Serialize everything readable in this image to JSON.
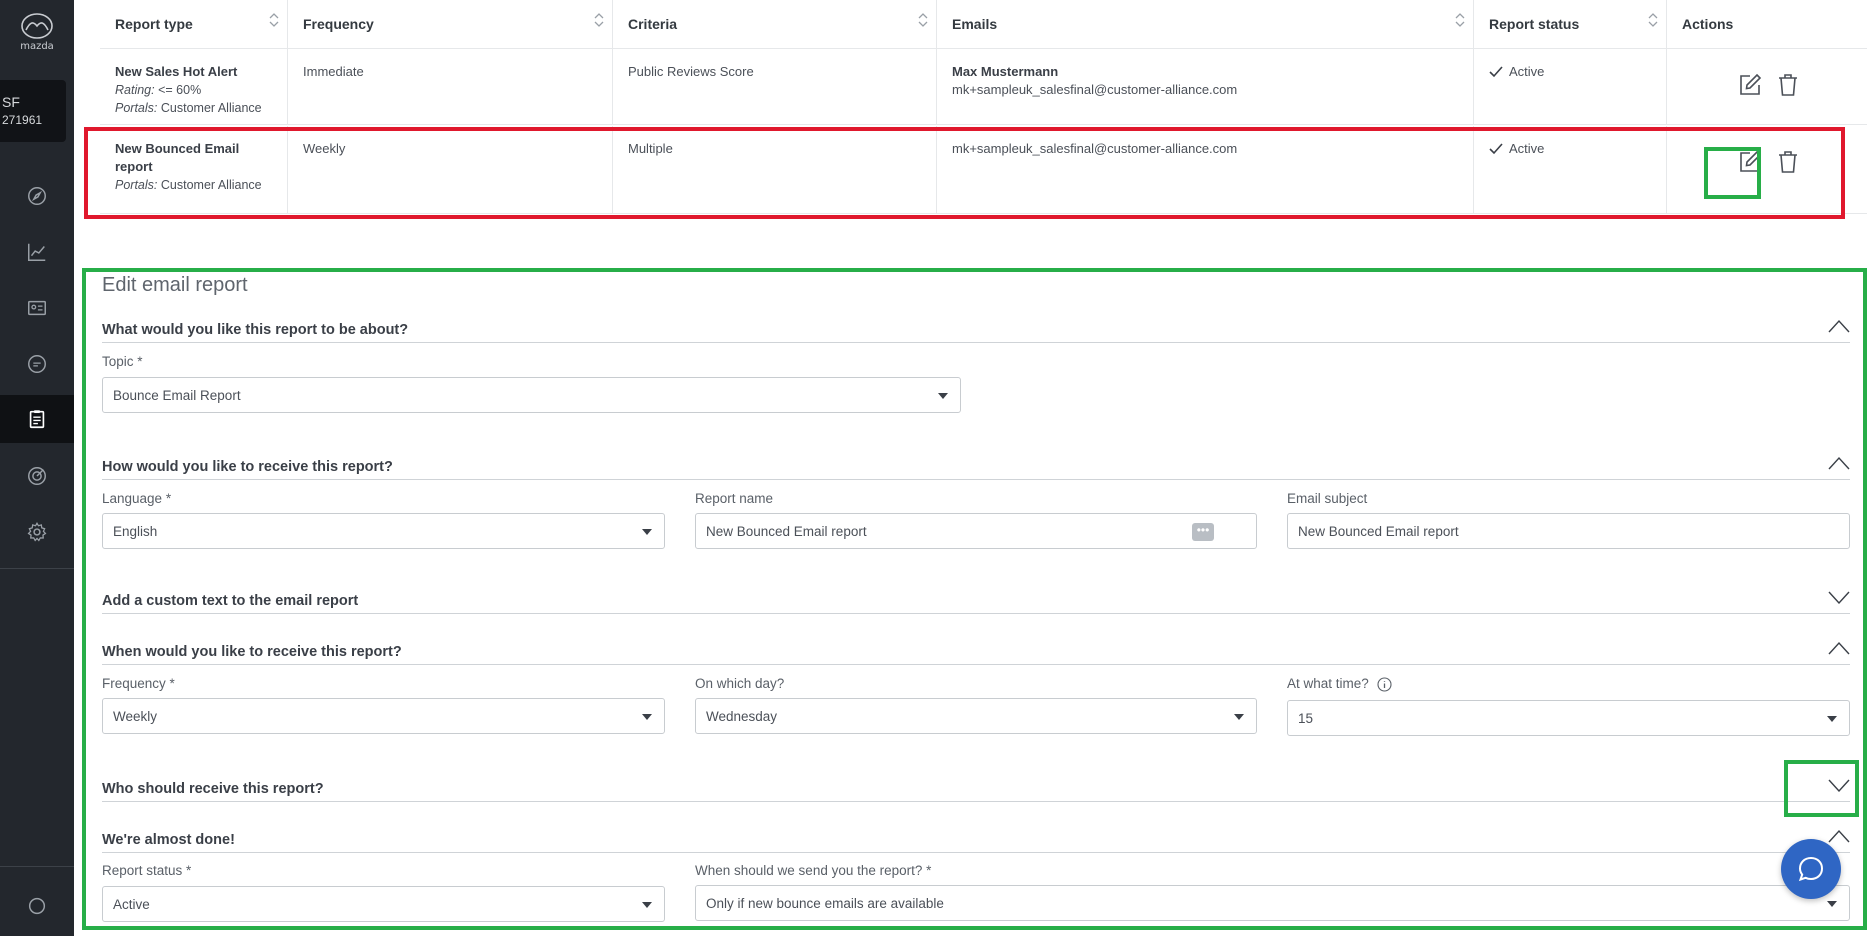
{
  "sidebar": {
    "logo_text": "mazda",
    "account": {
      "initials": "SF",
      "id": "271961"
    },
    "items": [
      {
        "icon": "compass-icon"
      },
      {
        "icon": "chart-line-icon"
      },
      {
        "icon": "id-card-icon"
      },
      {
        "icon": "chat-bubble-icon"
      },
      {
        "icon": "clipboard-icon",
        "active": true
      },
      {
        "icon": "target-icon"
      },
      {
        "icon": "gear-icon"
      }
    ],
    "bottom_icon": "circle-icon"
  },
  "table": {
    "headers": [
      "Report type",
      "Frequency",
      "Criteria",
      "Emails",
      "Report status",
      "Actions"
    ],
    "rows": [
      {
        "title": "New Sales Hot Alert",
        "rating_label": "Rating:",
        "rating_value": "<= 60%",
        "portals_label": "Portals:",
        "portals_value": "Customer Alliance",
        "frequency": "Immediate",
        "criteria": "Public Reviews Score",
        "email_name": "Max Mustermann",
        "email": "mk+sampleuk_salesfinal@customer-alliance.com",
        "status": "Active"
      },
      {
        "title": "New Bounced Email report",
        "portals_label": "Portals:",
        "portals_value": "Customer Alliance",
        "frequency": "Weekly",
        "criteria": "Multiple",
        "email": "mk+sampleuk_salesfinal@customer-alliance.com",
        "status": "Active"
      }
    ]
  },
  "form": {
    "title": "Edit email report",
    "sections": {
      "about": "What would you like this report to be about?",
      "receive": "How would you like to receive this report?",
      "custom_text": "Add a custom text to the email report",
      "when": "When would you like to receive this report?",
      "who": "Who should receive this report?",
      "done": "We're almost done!"
    },
    "topic": {
      "label": "Topic *",
      "value": "Bounce Email Report"
    },
    "language": {
      "label": "Language *",
      "value": "English"
    },
    "report_name": {
      "label": "Report name",
      "value": "New Bounced Email report"
    },
    "email_subject": {
      "label": "Email subject",
      "value": "New Bounced Email report"
    },
    "frequency": {
      "label": "Frequency *",
      "value": "Weekly"
    },
    "day": {
      "label": "On which day?",
      "value": "Wednesday"
    },
    "time": {
      "label": "At what time?",
      "value": "15"
    },
    "report_status": {
      "label": "Report status *",
      "value": "Active"
    },
    "send_when": {
      "label": "When should we send you the report? *",
      "value": "Only if new bounce emails are available"
    },
    "dots": "•••"
  },
  "colors": {
    "sidebar_bg": "#23272d",
    "highlight_red": "#e0182d",
    "highlight_green": "#27ae48",
    "chat_button": "#2f66c4"
  }
}
